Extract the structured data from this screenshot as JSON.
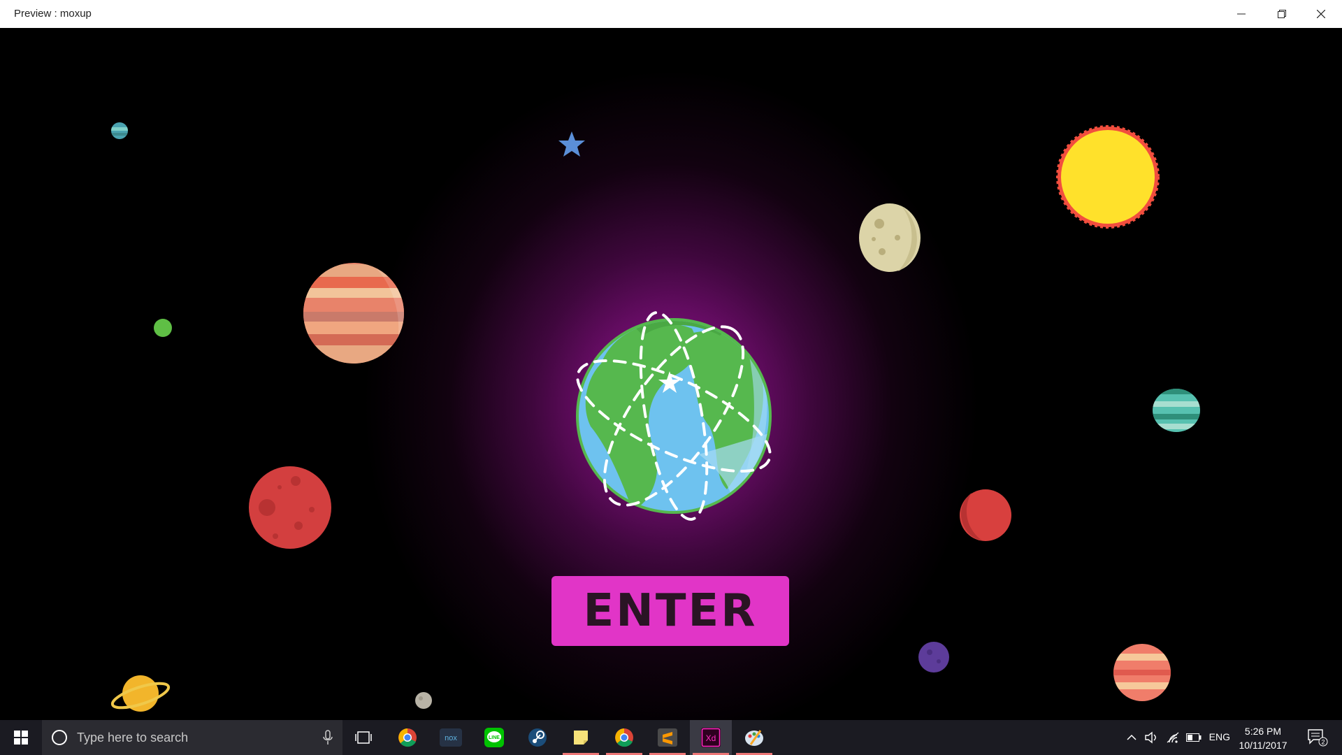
{
  "window": {
    "title": "Preview : moxup",
    "controls": [
      "minimize-icon",
      "restore-icon",
      "close-icon"
    ]
  },
  "scene": {
    "button_label": "ENTER",
    "colors": {
      "button": "#e135c7",
      "glow": "#a0169a",
      "background": "#000000"
    },
    "objects": [
      "earth",
      "sun",
      "moon",
      "jupiter",
      "mars",
      "saturn",
      "neptune",
      "venus",
      "star",
      "small-planets"
    ]
  },
  "taskbar": {
    "search_placeholder": "Type here to search",
    "apps": [
      "task-view-icon",
      "chrome-icon",
      "nox-icon",
      "line-icon",
      "steam-icon",
      "sticky-notes-icon",
      "chrome-icon",
      "sublime-text-icon",
      "adobe-xd-icon",
      "paint-icon"
    ],
    "nox_label": "nox",
    "line_label": "LINE",
    "xd_label": "Xd",
    "language": "ENG",
    "time": "5:26 PM",
    "date": "10/11/2017",
    "notification_count": "2"
  }
}
